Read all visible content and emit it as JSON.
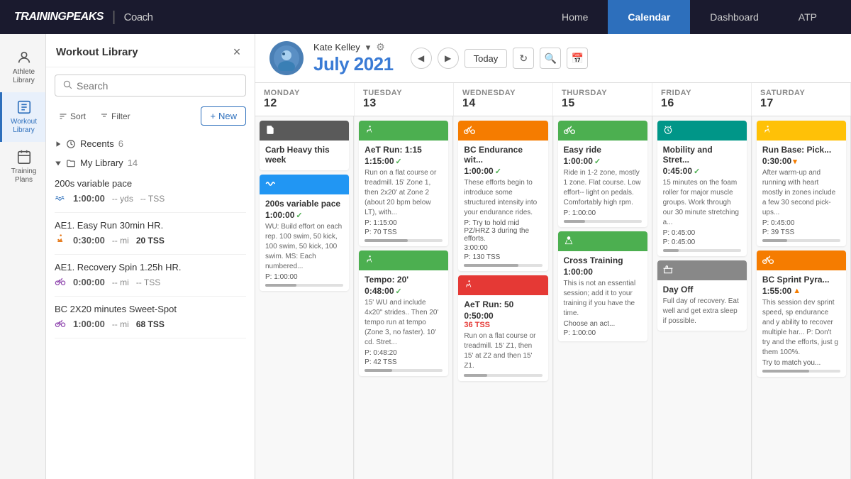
{
  "nav": {
    "brand": "TRAININGPEAKS",
    "divider": "|",
    "coach": "Coach",
    "links": [
      {
        "id": "home",
        "label": "Home",
        "active": false
      },
      {
        "id": "calendar",
        "label": "Calendar",
        "active": true
      },
      {
        "id": "dashboard",
        "label": "Dashboard",
        "active": false
      },
      {
        "id": "atp",
        "label": "ATP",
        "active": false
      }
    ]
  },
  "icon_sidebar": {
    "items": [
      {
        "id": "athlete-library",
        "label": "Athlete Library",
        "icon": "👤"
      },
      {
        "id": "workout-library",
        "label": "Workout Library",
        "icon": "📋",
        "active": true
      },
      {
        "id": "training-plans",
        "label": "Training Plans",
        "icon": "📅"
      }
    ]
  },
  "workout_panel": {
    "title": "Workout Library",
    "close_label": "×",
    "search_placeholder": "Search",
    "sort_label": "Sort",
    "filter_label": "Filter",
    "new_label": "+ New",
    "sections": [
      {
        "id": "recents",
        "label": "Recents",
        "count": 6,
        "expanded": false
      },
      {
        "id": "my-library",
        "label": "My Library",
        "count": 14,
        "expanded": true
      }
    ],
    "items": [
      {
        "id": "200s-variable",
        "name": "200s variable pace",
        "icon": "swim",
        "duration": "1:00:00",
        "distance": "-- yds",
        "tss": "-- TSS"
      },
      {
        "id": "ae1-easy-run",
        "name": "AE1. Easy Run 30min HR.",
        "icon": "run",
        "duration": "0:30:00",
        "distance": "-- mi",
        "tss": "20 TSS"
      },
      {
        "id": "ae1-recovery-spin",
        "name": "AE1. Recovery Spin 1.25h HR.",
        "icon": "bike",
        "duration": "0:00:00",
        "distance": "-- mi",
        "tss": "-- TSS"
      },
      {
        "id": "bc-2x20",
        "name": "BC 2X20 minutes Sweet-Spot",
        "icon": "bike",
        "duration": "1:00:00",
        "distance": "-- mi",
        "tss": "68 TSS"
      }
    ]
  },
  "calendar": {
    "athlete_name": "Kate Kelley",
    "month_year": "July  2021",
    "today_label": "Today",
    "days": [
      {
        "id": "monday",
        "label": "MONDAY",
        "num": "12"
      },
      {
        "id": "tuesday",
        "label": "TUESDAY",
        "num": "13"
      },
      {
        "id": "wednesday",
        "label": "WEDNESDAY",
        "num": "14"
      },
      {
        "id": "thursday",
        "label": "THURSDAY",
        "num": "15"
      },
      {
        "id": "friday",
        "label": "FRIDAY",
        "num": "16"
      },
      {
        "id": "saturday",
        "label": "SATURDAY",
        "num": "17"
      }
    ],
    "events": {
      "monday": [
        {
          "id": "carb-heavy",
          "type": "note",
          "color": "gray",
          "icon": "📄",
          "title": "Carb Heavy this week",
          "desc": ""
        },
        {
          "id": "200s-variable-mon",
          "type": "swim",
          "color": "blue",
          "icon": "🏊",
          "title": "200s variable pace",
          "duration": "1:00:00",
          "check": true,
          "desc": "WU: Build effort on each rep. 100 swim, 50 kick, 100 swim, 50 kick, 100 swim. MS: Each numbered...",
          "extra": "P: 1:00:00"
        }
      ],
      "tuesday": [
        {
          "id": "aet-run",
          "type": "run",
          "color": "green",
          "icon": "🏃",
          "title": "AeT Run: 1:15",
          "duration": "1:15:00",
          "check": true,
          "desc": "Run on a flat course or treadmill. 15' Zone 1, then 2x20' at Zone 2 (about 20 bpm below LT), with...",
          "p1": "P: 1:15:00",
          "p2": "P: 70 TSS"
        },
        {
          "id": "tempo-20",
          "type": "run",
          "color": "green",
          "icon": "🏃",
          "title": "Tempo: 20'",
          "duration": "0:48:00",
          "check": true,
          "desc": "15' WU and include 4x20\" strides.. Then 20' tempo run at tempo (Zone 3, no faster). 10' cd. Stret...",
          "p1": "P: 0:48:20",
          "p2": "P: 42 TSS"
        }
      ],
      "wednesday": [
        {
          "id": "bc-endurance",
          "type": "bike",
          "color": "orange",
          "icon": "🚴",
          "title": "BC Endurance wit...",
          "duration": "1:00:00",
          "check": true,
          "desc": "These efforts begin to introduce some structured intensity into your endurance rides.",
          "p1": "P: Try to hold mid PZ/HRZ 3 during the efforts.",
          "p2": "3:00:00",
          "p3": "P: 130 TSS"
        },
        {
          "id": "aet-run-50",
          "type": "run",
          "color": "red",
          "icon": "🏃",
          "title": "AeT Run: 50",
          "duration": "0:50:00",
          "tss": "36 TSS",
          "desc": "Run on a flat course or treadmill. 15' Z1, then 15' at Z2 and then 15' Z1."
        }
      ],
      "thursday": [
        {
          "id": "easy-ride",
          "type": "bike",
          "color": "green",
          "icon": "🚴",
          "title": "Easy ride",
          "duration": "1:00:00",
          "check": true,
          "desc": "Ride in 1-2 zone, mostly 1 zone. Flat course. Low effort-- light on pedals. Comfortably high rpm.",
          "extra": "P: 1:00:00"
        },
        {
          "id": "cross-training",
          "type": "kettlebell",
          "color": "green",
          "icon": "🏋️",
          "title": "Cross Training",
          "duration": "1:00:00",
          "check": false,
          "desc": "This is not an essential session; add it to your training if you have the time.",
          "extra": "Choose an act...",
          "p1": "P: 1:00:00"
        }
      ],
      "friday": [
        {
          "id": "mobility",
          "type": "timer",
          "color": "teal",
          "icon": "⏱️",
          "title": "Mobility and Stret...",
          "duration": "0:45:00",
          "check": true,
          "desc": "15 minutes on the foam roller for major muscle groups. Work through our 30 minute stretching a...",
          "p1": "P: 0:45:00",
          "p2": "P: 0:45:00"
        },
        {
          "id": "day-off",
          "type": "dayoff",
          "color": "gray",
          "icon": "🛏️",
          "title": "Day Off",
          "desc": "Full day of recovery. Eat well and get extra sleep if possible."
        }
      ],
      "saturday": [
        {
          "id": "run-base",
          "type": "run",
          "color": "yellow",
          "icon": "🏃",
          "title": "Run Base: Pick...",
          "duration": "0:30:00",
          "check": true,
          "desc": "After warm-up and running with heart mostly in zones include a few 30 second pick-ups...",
          "p1": "P: 0:45:00",
          "p2": "P: 39 TSS"
        },
        {
          "id": "bc-sprint",
          "type": "bike",
          "color": "orange",
          "icon": "🚴",
          "title": "BC Sprint Pyra...",
          "duration": "1:55:00",
          "check": true,
          "desc": "This session dev sprint speed, sp endurance and y ability to recover multiple har... P: Don't try and the efforts, just g them 100%.",
          "extra": "Try to match you..."
        }
      ]
    }
  }
}
